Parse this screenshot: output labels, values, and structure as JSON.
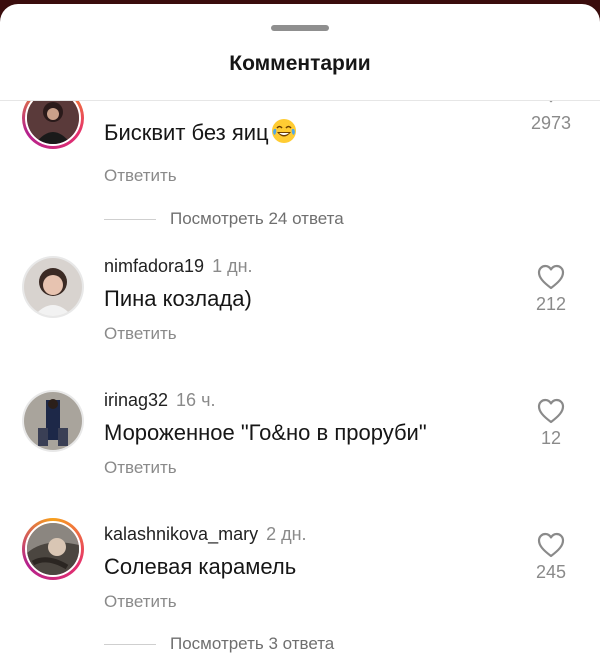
{
  "header": {
    "title": "Комментарии"
  },
  "comments": [
    {
      "username": "",
      "time": "",
      "text": "Бисквит без яиц",
      "emoji": "tears-of-joy-emoji",
      "reply_label": "Ответить",
      "likes": "2973",
      "view_replies": "Посмотреть 24 ответа"
    },
    {
      "username": "nimfadora19",
      "time": "1 дн.",
      "text": "Пина козлада)",
      "reply_label": "Ответить",
      "likes": "212"
    },
    {
      "username": "irinag32",
      "time": "16 ч.",
      "text": "Мороженное \"Го&но в проруби\"",
      "reply_label": "Ответить",
      "likes": "12"
    },
    {
      "username": "kalashnikova_mary",
      "time": "2 дн.",
      "text": "Солевая карамель",
      "reply_label": "Ответить",
      "likes": "245",
      "view_replies": "Посмотреть 3 ответа"
    }
  ],
  "icons": {
    "like": "heart-outline-icon"
  },
  "colors": {
    "story_ring_start": "#f7a01c",
    "story_ring_mid": "#e5306d",
    "muted_text": "#8a8a8a"
  }
}
